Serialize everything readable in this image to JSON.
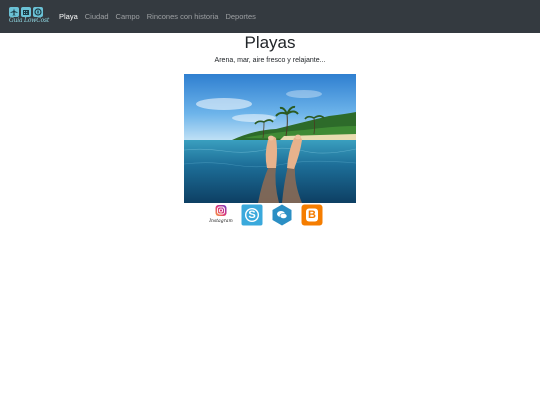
{
  "brand": {
    "text": "Guia LowCost",
    "icons": [
      "plane-icon",
      "hotel-icon",
      "savings-icon"
    ]
  },
  "nav": {
    "items": [
      {
        "label": "Playa",
        "active": true
      },
      {
        "label": "Ciudad",
        "active": false
      },
      {
        "label": "Campo",
        "active": false
      },
      {
        "label": "Rincones con historia",
        "active": false
      },
      {
        "label": "Deportes",
        "active": false
      }
    ]
  },
  "main": {
    "title": "Playas",
    "subtitle": "Arena, mar, aire fresco y relajante..."
  },
  "social": {
    "items": [
      {
        "name": "instagram",
        "caption": "Instagram"
      },
      {
        "name": "skype",
        "letter": "S"
      },
      {
        "name": "chat"
      },
      {
        "name": "blogger",
        "letter": "B"
      }
    ]
  },
  "colors": {
    "navbar": "#343a40",
    "skype": "#3aa9dc",
    "chat": "#2b8fc4",
    "blogger": "#f57d00"
  }
}
